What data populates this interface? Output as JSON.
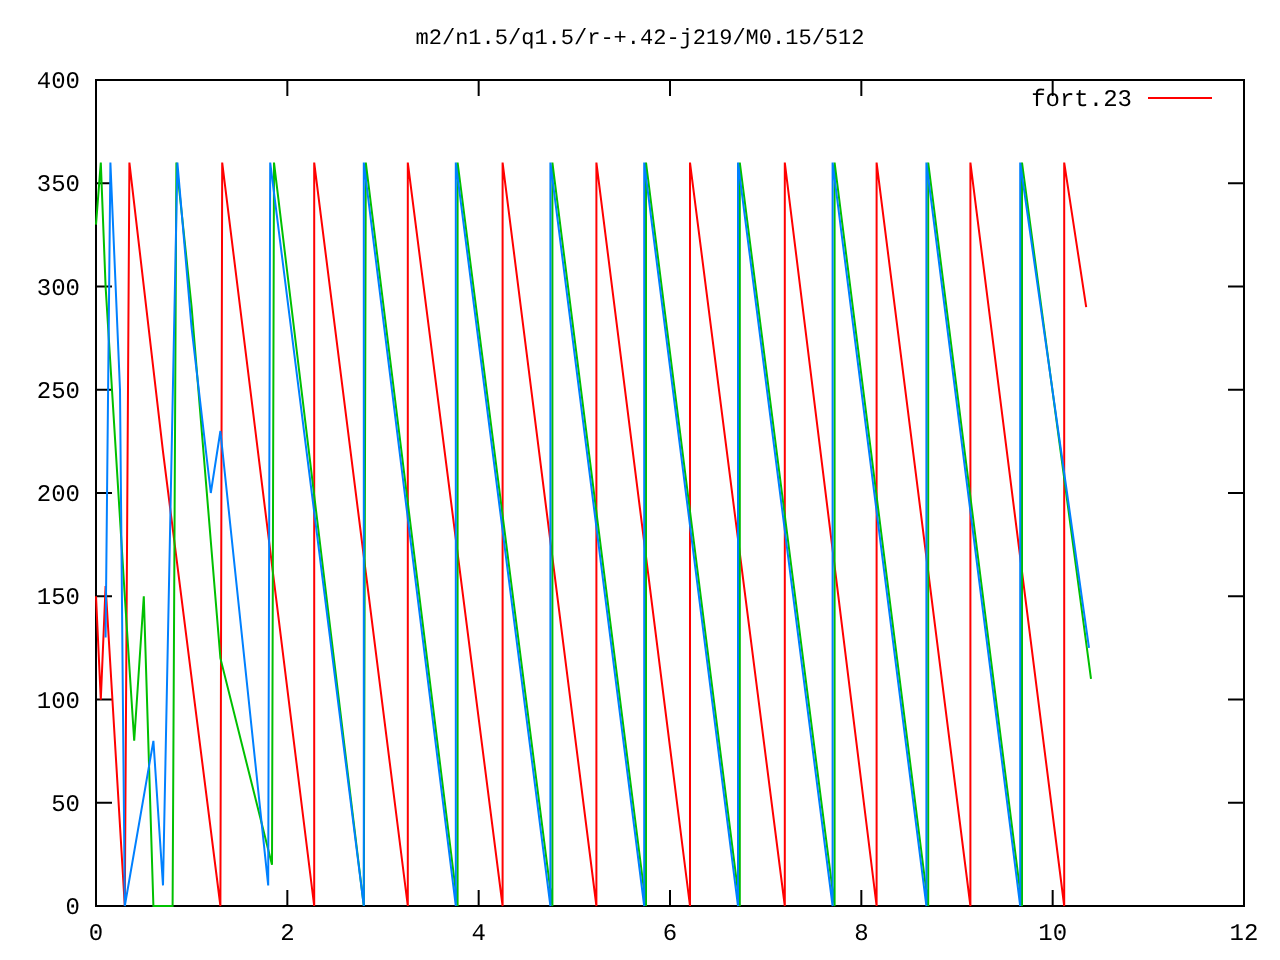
{
  "chart_data": {
    "type": "line",
    "title": "m2/n1.5/q1.5/r-+.42-j219/M0.15/512",
    "xlim": [
      0,
      12
    ],
    "ylim": [
      0,
      400
    ],
    "xticks": [
      0,
      2,
      4,
      6,
      8,
      10,
      12
    ],
    "yticks": [
      0,
      50,
      100,
      150,
      200,
      250,
      300,
      350,
      400
    ],
    "series": [
      {
        "name": "fort.23",
        "color": "#ff0000",
        "x": [
          0,
          0.05,
          0.1,
          0.3,
          0.35,
          0.7,
          1.3,
          1.32,
          2.28,
          2.28,
          3.26,
          3.26,
          4.25,
          4.25,
          5.23,
          5.23,
          6.21,
          6.21,
          7.2,
          7.2,
          8.16,
          8.16,
          9.14,
          9.14,
          10.12,
          10.12,
          10.35
        ],
        "values": [
          150,
          100,
          155,
          0,
          360,
          220,
          0,
          360,
          0,
          360,
          0,
          360,
          0,
          360,
          0,
          360,
          0,
          360,
          0,
          360,
          0,
          360,
          0,
          360,
          0,
          360,
          290
        ]
      },
      {
        "color": "#00c000",
        "x": [
          0,
          0.05,
          0.1,
          0.3,
          0.4,
          0.5,
          0.6,
          0.8,
          0.84,
          1.0,
          1.3,
          1.84,
          1.86,
          2.8,
          2.82,
          3.78,
          3.78,
          4.77,
          4.77,
          5.75,
          5.75,
          6.73,
          6.73,
          7.72,
          7.72,
          8.7,
          8.7,
          9.68,
          9.68,
          10.4
        ],
        "values": [
          330,
          360,
          300,
          150,
          80,
          150,
          0,
          0,
          360,
          290,
          120,
          20,
          360,
          0,
          360,
          0,
          360,
          0,
          360,
          0,
          360,
          0,
          360,
          0,
          360,
          0,
          360,
          0,
          360,
          110
        ]
      },
      {
        "color": "#0080ff",
        "x": [
          0.1,
          0.15,
          0.25,
          0.3,
          0.6,
          0.7,
          0.85,
          1.0,
          1.2,
          1.3,
          1.8,
          1.82,
          2.8,
          2.8,
          3.76,
          3.76,
          4.75,
          4.75,
          5.73,
          5.73,
          6.71,
          6.71,
          7.7,
          7.7,
          8.68,
          8.68,
          9.66,
          9.66,
          10.38
        ],
        "values": [
          130,
          360,
          250,
          0,
          80,
          10,
          360,
          280,
          200,
          230,
          10,
          360,
          0,
          360,
          0,
          360,
          0,
          360,
          0,
          360,
          0,
          360,
          0,
          360,
          0,
          360,
          0,
          360,
          125
        ]
      }
    ]
  }
}
